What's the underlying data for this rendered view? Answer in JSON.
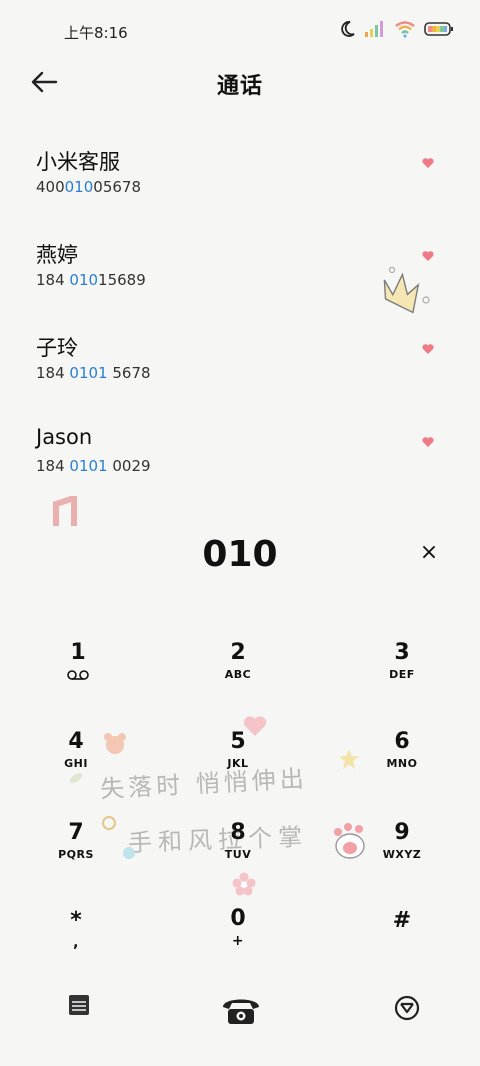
{
  "status": {
    "time": "上午8:16"
  },
  "header": {
    "title": "通话"
  },
  "contacts": [
    {
      "name": "小米客服",
      "num_pre": "400",
      "num_hl": "010",
      "num_post": "05678"
    },
    {
      "name": "燕婷",
      "num_pre": "184 ",
      "num_hl": "010",
      "num_post": "15689"
    },
    {
      "name": "子玲",
      "num_pre": "184 ",
      "num_hl": "0101",
      "num_post": " 5678"
    },
    {
      "name": "Jason",
      "num_pre": "184 ",
      "num_hl": "0101",
      "num_post": " 0029"
    }
  ],
  "dialer": {
    "input": "010",
    "clear": "×",
    "keys": [
      {
        "digit": "1",
        "letters": "voicemail"
      },
      {
        "digit": "2",
        "letters": "ABC"
      },
      {
        "digit": "3",
        "letters": "DEF"
      },
      {
        "digit": "4",
        "letters": "GHI"
      },
      {
        "digit": "5",
        "letters": "JKL"
      },
      {
        "digit": "6",
        "letters": "MNO"
      },
      {
        "digit": "7",
        "letters": "PQRS"
      },
      {
        "digit": "8",
        "letters": "TUV"
      },
      {
        "digit": "9",
        "letters": "WXYZ"
      },
      {
        "digit": "*",
        "letters": ","
      },
      {
        "digit": "0",
        "letters": "+"
      },
      {
        "digit": "#",
        "letters": ""
      }
    ]
  },
  "wallpaper_text": {
    "line1": "失落时 悄悄伸出",
    "line2": "手和风拉个掌"
  },
  "colors": {
    "accent": "#2a7fd4",
    "heart": "#f07a86",
    "background": "#f6f6f4"
  },
  "icons": {
    "back": "arrow-left-icon",
    "menu": "dialpad-menu-icon",
    "call": "telephone-icon",
    "hide": "hide-keypad-icon"
  }
}
